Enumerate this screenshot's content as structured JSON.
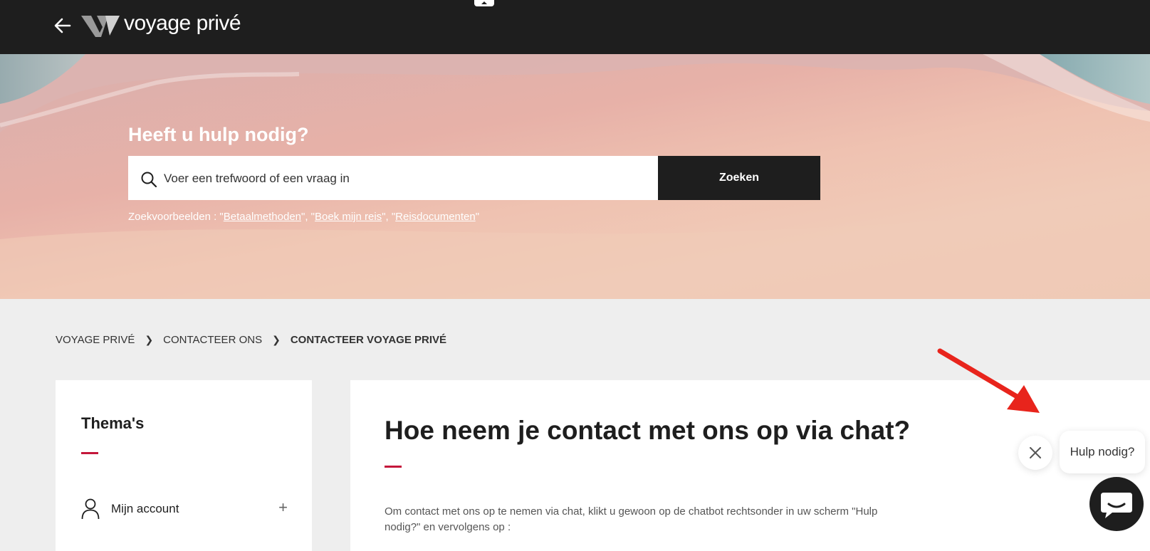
{
  "header": {
    "logo_text": "voyage privé",
    "back_icon": "arrow-left-icon",
    "logo_icon": "voyage-prive-v-logo"
  },
  "hero": {
    "title": "Heeft u hulp nodig?",
    "search_placeholder": "Voer een trefwoord of een vraag in",
    "search_button": "Zoeken",
    "examples_prefix": "Zoekvoorbeelden : \"",
    "examples": [
      "Betaalmethoden",
      "Boek mijn reis",
      "Reisdocumenten"
    ],
    "examples_sep": "\", \"",
    "examples_suffix": "\""
  },
  "breadcrumb": [
    "VOYAGE PRIVÉ",
    "CONTACTEER ONS",
    "CONTACTEER VOYAGE PRIVÉ"
  ],
  "sidebar": {
    "title": "Thema's",
    "items": [
      {
        "label": "Mijn account",
        "icon": "user-icon"
      }
    ]
  },
  "main": {
    "title": "Hoe neem je contact met ons op via chat?",
    "intro": "Om contact met ons op te nemen via chat, klikt u gewoon op de chatbot rechtsonder in uw scherm \"Hulp nodig?\" en vervolgens op :"
  },
  "chat": {
    "help_label": "Hulp nodig?",
    "close_icon": "close-icon",
    "chat_icon": "chat-bubble-icon"
  },
  "colors": {
    "header_bg": "#1e1e1e",
    "accent": "#c4173b",
    "annotation_arrow": "#e8241c"
  }
}
